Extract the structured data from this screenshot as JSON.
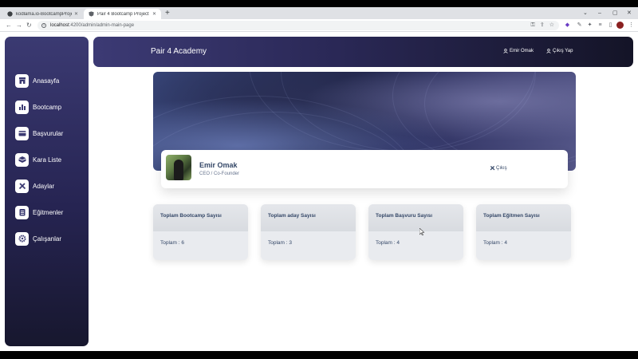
{
  "browser": {
    "tabs": [
      {
        "title": "kodlama.io-BootcampProject/fr..."
      },
      {
        "title": "Pair 4 Bootcamp Project"
      }
    ],
    "url_host": "localhost",
    "url_rest": ":4200/admin/admin-main-page"
  },
  "app": {
    "brand": "Pair 4 Academy",
    "header_links": {
      "user": "Emir Omak",
      "logout": "Çıkış Yap"
    },
    "sidebar": {
      "items": [
        {
          "label": "Anasayfa",
          "icon": "store-icon"
        },
        {
          "label": "Bootcamp",
          "icon": "chart-icon"
        },
        {
          "label": "Başvurular",
          "icon": "card-icon"
        },
        {
          "label": "Kara Liste",
          "icon": "box-icon"
        },
        {
          "label": "Adaylar",
          "icon": "tools-icon"
        },
        {
          "label": "Eğitmenler",
          "icon": "list-icon"
        },
        {
          "label": "Çalışanlar",
          "icon": "gear-icon"
        }
      ]
    },
    "profile": {
      "name": "Emir Omak",
      "role": "CEO / Co-Founder",
      "logout": "Çıkış"
    },
    "cards": [
      {
        "title": "Toplam Bootcamp Sayısı",
        "value": "Toplam : 6"
      },
      {
        "title": "Toplam aday Sayısı",
        "value": "Toplam : 3"
      },
      {
        "title": "Toplam Başvuru Sayısı",
        "value": "Toplam : 4"
      },
      {
        "title": "Toplam Eğitmen Sayısı",
        "value": "Toplam : 4"
      }
    ]
  },
  "colors": {
    "sidebar_top": "#3b3a72",
    "sidebar_bottom": "#17172e",
    "text_dark": "#344767"
  }
}
